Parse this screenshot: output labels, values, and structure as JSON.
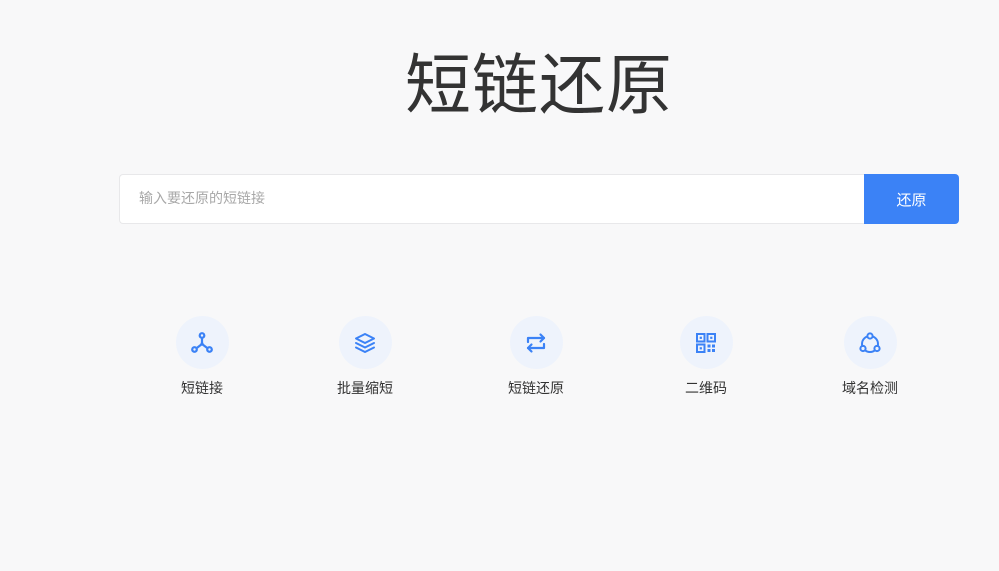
{
  "page": {
    "title": "短链还原"
  },
  "search": {
    "placeholder": "输入要还原的短链接",
    "value": "",
    "button_label": "还原"
  },
  "features": [
    {
      "label": "短链接",
      "icon": "share-nodes-icon"
    },
    {
      "label": "批量缩短",
      "icon": "layers-icon"
    },
    {
      "label": "短链还原",
      "icon": "swap-arrows-icon"
    },
    {
      "label": "二维码",
      "icon": "qrcode-icon"
    },
    {
      "label": "域名检测",
      "icon": "network-circle-icon"
    }
  ],
  "colors": {
    "accent": "#3b82f6",
    "background": "#f8f8f9",
    "icon_bg": "#eef3fc",
    "title": "#333333"
  }
}
